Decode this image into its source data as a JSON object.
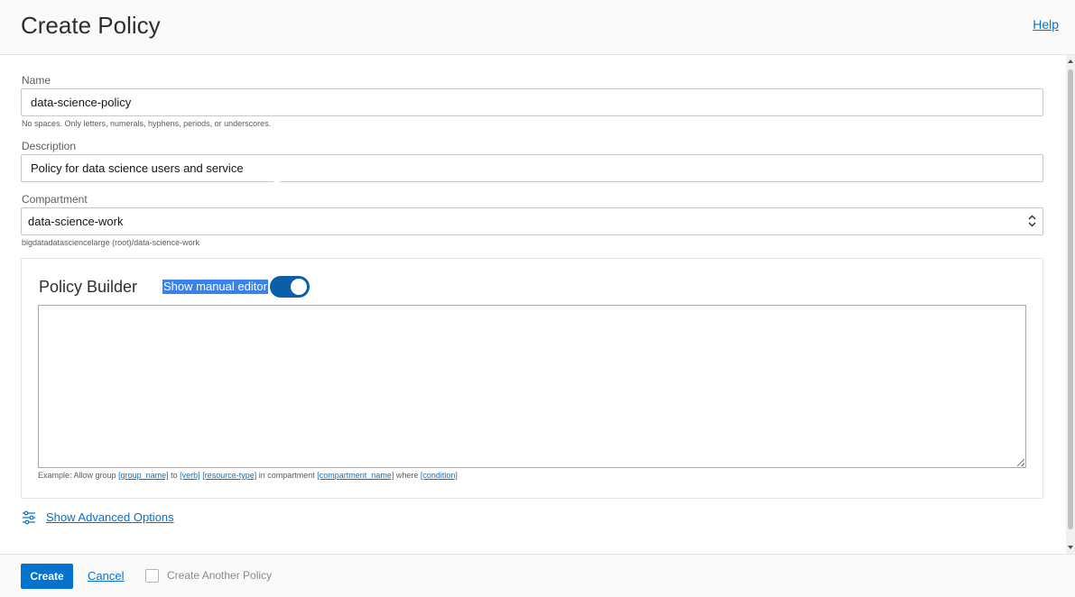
{
  "header": {
    "title": "Create Policy",
    "help_label": "Help"
  },
  "form": {
    "name": {
      "label": "Name",
      "value": "data-science-policy",
      "hint": "No spaces. Only letters, numerals, hyphens, periods, or underscores."
    },
    "description": {
      "label": "Description",
      "value": "Policy for data science users and service"
    },
    "compartment": {
      "label": "Compartment",
      "value": "data-science-work",
      "path": "bigdatadatasciencelarge (root)/data-science-work"
    }
  },
  "policy_builder": {
    "title": "Policy Builder",
    "manual_editor_label": "Show manual editor",
    "manual_editor_enabled": true,
    "editor_text": "",
    "example": {
      "prefix": "Example: Allow group",
      "group_token": "[group_name]",
      "to": "to",
      "verb_token": "[verb]",
      "resource_token": "[resource-type]",
      "in_compartment": "in compartment",
      "compartment_token": "[compartment_name]",
      "where": "where",
      "condition_token": "[condition]"
    }
  },
  "advanced": {
    "label": "Show Advanced Options",
    "icon": "sliders-icon"
  },
  "footer": {
    "create_label": "Create",
    "cancel_label": "Cancel",
    "create_another_label": "Create Another Policy",
    "create_another_checked": false
  },
  "colors": {
    "accent": "#0572ce",
    "toggle_on": "#0a5fa8",
    "selection": "#3b82e8"
  }
}
